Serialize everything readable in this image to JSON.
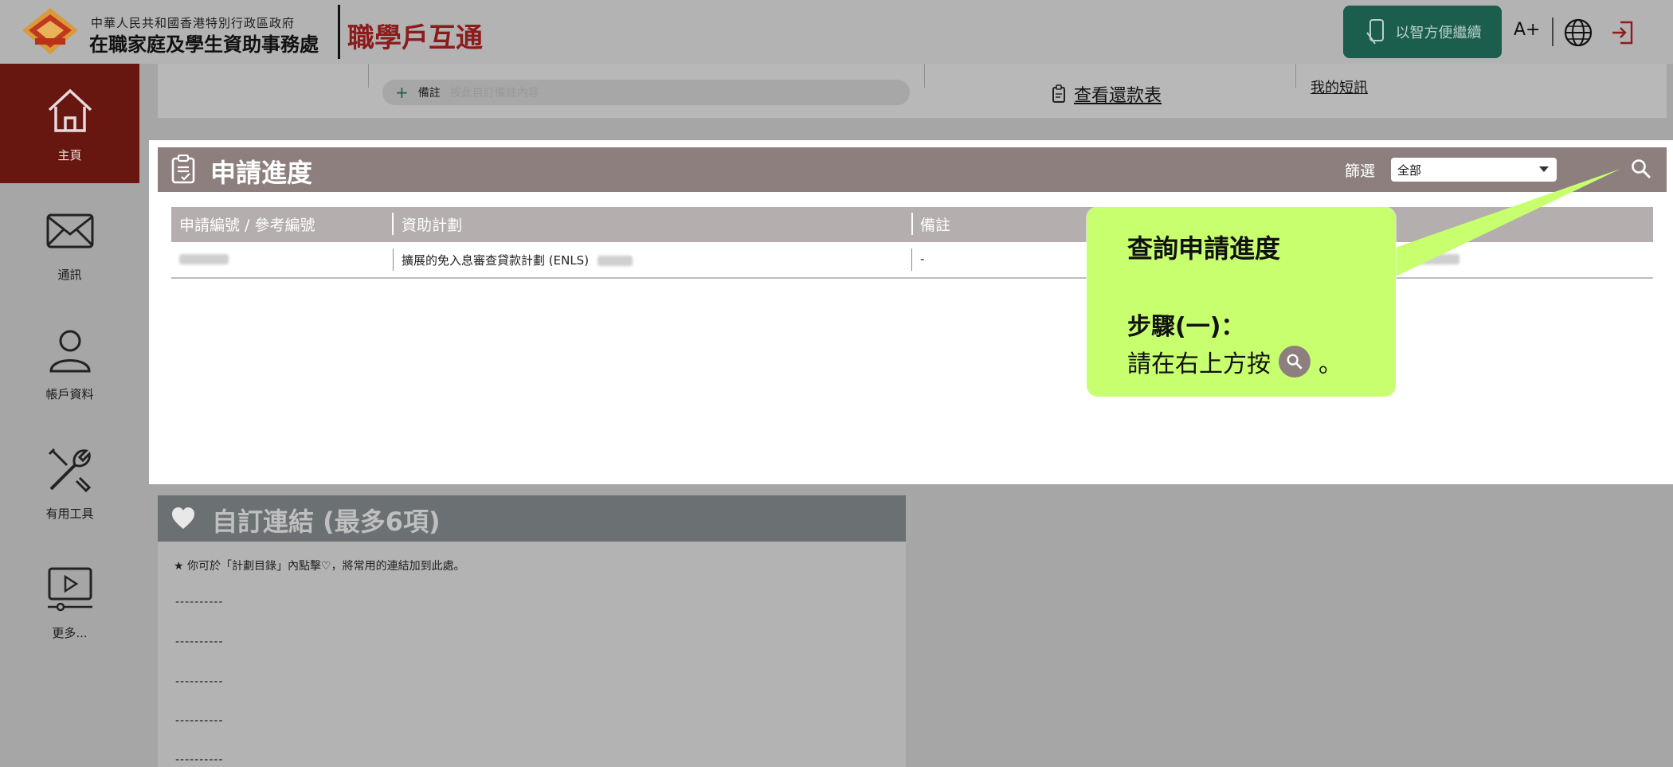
{
  "header": {
    "dept_line1": "中華人民共和國香港特別行政區政府",
    "dept_line2": "在職家庭及學生資助事務處",
    "brand": "職學戶互通",
    "smart_button": "以智方便繼續",
    "font_size": "A+"
  },
  "sidebar": {
    "items": [
      {
        "label": "主頁"
      },
      {
        "label": "通訊"
      },
      {
        "label": "帳戶資料"
      },
      {
        "label": "有用工具"
      },
      {
        "label": "更多..."
      }
    ]
  },
  "top_panel": {
    "notes_label": "備註",
    "notes_placeholder": "按此自訂備註內容",
    "repayment_link": "查看還款表",
    "messages_link": "我的短訊"
  },
  "progress": {
    "title": "申請進度",
    "filter_label": "篩選",
    "filter_value": "全部",
    "columns": [
      "申請編號 / 參考編號",
      "資助計劃",
      "備註"
    ],
    "rows": [
      {
        "scheme": "擴展的免入息審查貸款計劃 (ENLS)",
        "remark": "-"
      }
    ]
  },
  "links": {
    "title": "自訂連結 (最多6項)",
    "note": "你可於「計劃目錄」內點擊♡，將常用的連結加到此處。",
    "placeholders": [
      "----------",
      "----------",
      "----------",
      "----------",
      "----------"
    ]
  },
  "callout": {
    "title": "查詢申請進度",
    "step": "步驟(一)：",
    "text_before": "請在右上方按",
    "text_after": "。"
  },
  "colors": {
    "brand_red": "#8e1b1b",
    "active_sidebar": "#671610",
    "smart_green": "#1c5e4e",
    "progress_header": "#8e7f7f",
    "callout_green": "#c8ff6e"
  }
}
